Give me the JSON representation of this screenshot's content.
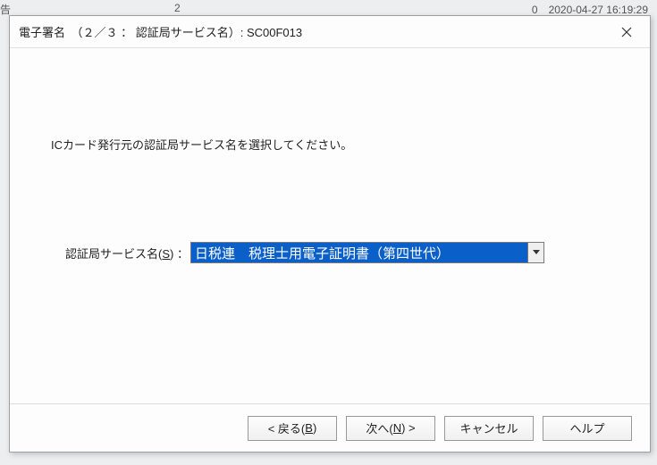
{
  "background": {
    "left_fragment": "告",
    "number_fragment": "2",
    "date_fragment": "0　2020-04-27 16:19:29"
  },
  "dialog": {
    "title": "電子署名　（２／３ ： 認証局サービス名）: SC00F013",
    "close_name": "close",
    "instruction": "ICカード発行元の認証局サービス名を選択してください。",
    "field_label_prefix": "認証局サービス名(",
    "field_label_mnemonic": "S",
    "field_label_suffix": ") ：",
    "combo_selected": "日税連　税理士用電子証明書（第四世代）",
    "buttons": {
      "back_prefix": "< 戻る(",
      "back_mnemonic": "B",
      "back_suffix": ")",
      "next_prefix": "次へ(",
      "next_mnemonic": "N",
      "next_suffix": ") >",
      "cancel": "キャンセル",
      "help": "ヘルプ"
    }
  }
}
